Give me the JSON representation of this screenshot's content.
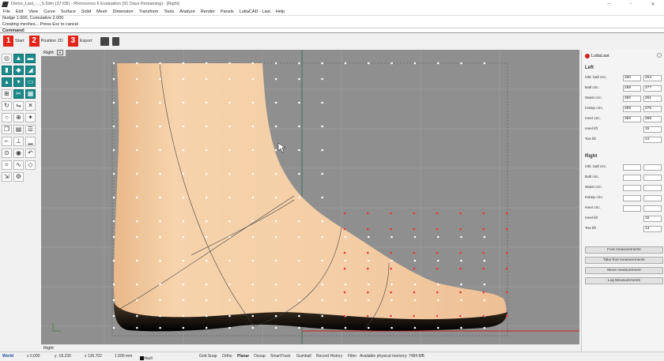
{
  "title": "Demo_Last_..._5.3dm (37 KB) - Rhinoceros 6 Evaluation (91 Days Remaining) - [Right]",
  "window_buttons": [
    "–",
    "▫",
    "✕"
  ],
  "menu": [
    "File",
    "Edit",
    "View",
    "Curve",
    "Surface",
    "Solid",
    "Mesh",
    "Dimension",
    "Transform",
    "Tools",
    "Analyze",
    "Render",
    "Panels",
    "LuttaCAD - Last",
    "Help"
  ],
  "command_history": [
    "Nudge 1.000, Cumulative 2.000",
    "Creating meshes... Press Esc to cancel"
  ],
  "command_prompt": "Command:",
  "steps": [
    {
      "num": "1",
      "label": "Start"
    },
    {
      "num": "2",
      "label": "Position 2D"
    },
    {
      "num": "3",
      "label": "Export"
    }
  ],
  "viewport": {
    "tab": "Right",
    "bottom_tab": "Right"
  },
  "status": {
    "cplane": "World",
    "x": "x 0.000",
    "y": "y -18.230",
    "z": "z 136.702",
    "units": "1.000 mm",
    "layer": "Default",
    "grid_snap": "Grid Snap",
    "ortho": "Ortho",
    "planar": "Planar",
    "osnap": "Osnap",
    "smarttrack": "SmartTrack",
    "gumball": "Gumball",
    "record_history": "Record History",
    "filter": "Filter",
    "memory": "Available physical memory: 7484 MB"
  },
  "panel": {
    "title": "LuttaLast",
    "left_header": "Left",
    "right_header": "Right",
    "left_rows": [
      {
        "label": "Obl. ball circ.",
        "a": "280",
        "b": "254"
      },
      {
        "label": "Ball circ.",
        "a": "288",
        "b": "277"
      },
      {
        "label": "Waist circ.",
        "a": "250",
        "b": "261"
      },
      {
        "label": "Instep circ.",
        "a": "269",
        "b": "275"
      },
      {
        "label": "Heel circ.",
        "a": "369",
        "b": "369"
      }
    ],
    "left_lifts": [
      {
        "label": "Heel lift",
        "value": "15"
      },
      {
        "label": "Toe lift",
        "value": "14"
      }
    ],
    "right_rows": [
      {
        "label": "Obl. ball circ.",
        "a": "",
        "b": ""
      },
      {
        "label": "Ball circ.",
        "a": "",
        "b": ""
      },
      {
        "label": "Waist circ.",
        "a": "",
        "b": ""
      },
      {
        "label": "Instep circ.",
        "a": "",
        "b": ""
      },
      {
        "label": "Heel circ.",
        "a": "",
        "b": ""
      }
    ],
    "right_lifts": [
      {
        "label": "Heel lift",
        "value": "15"
      },
      {
        "label": "Toe lift",
        "value": "13"
      }
    ],
    "buttons": [
      "Foot measurements",
      "Take foot measurements",
      "Move measurement",
      "Log Measurements"
    ]
  },
  "colors": {
    "accent": "#e2231a",
    "tool_teal": "#1a8a8a",
    "viewport": "#8f8f8f",
    "foot": "#f0c8a0"
  }
}
